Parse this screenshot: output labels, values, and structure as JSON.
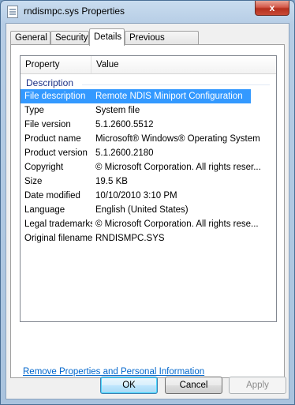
{
  "window": {
    "title": "rndismpc.sys Properties",
    "close_glyph": "x"
  },
  "tabs": [
    {
      "label": "General",
      "active": false
    },
    {
      "label": "Security",
      "active": false
    },
    {
      "label": "Details",
      "active": true
    },
    {
      "label": "Previous Versions",
      "active": false
    }
  ],
  "details": {
    "columns": {
      "property": "Property",
      "value": "Value"
    },
    "group": "Description",
    "rows": [
      {
        "property": "File description",
        "value": "Remote NDIS Miniport Configuration",
        "selected": true
      },
      {
        "property": "Type",
        "value": "System file"
      },
      {
        "property": "File version",
        "value": "5.1.2600.5512"
      },
      {
        "property": "Product name",
        "value": "Microsoft® Windows® Operating System"
      },
      {
        "property": "Product version",
        "value": "5.1.2600.2180"
      },
      {
        "property": "Copyright",
        "value": "© Microsoft Corporation. All rights reser..."
      },
      {
        "property": "Size",
        "value": "19.5 KB"
      },
      {
        "property": "Date modified",
        "value": "10/10/2010 3:10 PM"
      },
      {
        "property": "Language",
        "value": "English (United States)"
      },
      {
        "property": "Legal trademarks",
        "value": "© Microsoft Corporation. All rights rese..."
      },
      {
        "property": "Original filename",
        "value": "RNDISMPC.SYS"
      }
    ]
  },
  "link": {
    "remove_properties": "Remove Properties and Personal Information"
  },
  "buttons": {
    "ok": "OK",
    "cancel": "Cancel",
    "apply": "Apply"
  }
}
